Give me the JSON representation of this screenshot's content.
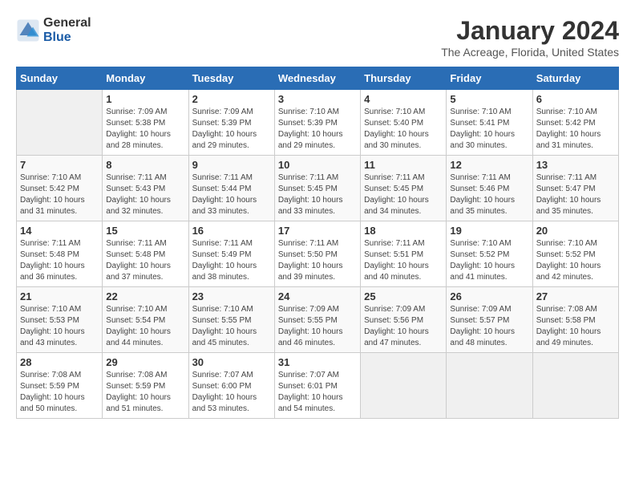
{
  "logo": {
    "general": "General",
    "blue": "Blue"
  },
  "title": "January 2024",
  "subtitle": "The Acreage, Florida, United States",
  "days_of_week": [
    "Sunday",
    "Monday",
    "Tuesday",
    "Wednesday",
    "Thursday",
    "Friday",
    "Saturday"
  ],
  "weeks": [
    [
      {
        "day": "",
        "info": ""
      },
      {
        "day": "1",
        "info": "Sunrise: 7:09 AM\nSunset: 5:38 PM\nDaylight: 10 hours\nand 28 minutes."
      },
      {
        "day": "2",
        "info": "Sunrise: 7:09 AM\nSunset: 5:39 PM\nDaylight: 10 hours\nand 29 minutes."
      },
      {
        "day": "3",
        "info": "Sunrise: 7:10 AM\nSunset: 5:39 PM\nDaylight: 10 hours\nand 29 minutes."
      },
      {
        "day": "4",
        "info": "Sunrise: 7:10 AM\nSunset: 5:40 PM\nDaylight: 10 hours\nand 30 minutes."
      },
      {
        "day": "5",
        "info": "Sunrise: 7:10 AM\nSunset: 5:41 PM\nDaylight: 10 hours\nand 30 minutes."
      },
      {
        "day": "6",
        "info": "Sunrise: 7:10 AM\nSunset: 5:42 PM\nDaylight: 10 hours\nand 31 minutes."
      }
    ],
    [
      {
        "day": "7",
        "info": "Sunrise: 7:10 AM\nSunset: 5:42 PM\nDaylight: 10 hours\nand 31 minutes."
      },
      {
        "day": "8",
        "info": "Sunrise: 7:11 AM\nSunset: 5:43 PM\nDaylight: 10 hours\nand 32 minutes."
      },
      {
        "day": "9",
        "info": "Sunrise: 7:11 AM\nSunset: 5:44 PM\nDaylight: 10 hours\nand 33 minutes."
      },
      {
        "day": "10",
        "info": "Sunrise: 7:11 AM\nSunset: 5:45 PM\nDaylight: 10 hours\nand 33 minutes."
      },
      {
        "day": "11",
        "info": "Sunrise: 7:11 AM\nSunset: 5:45 PM\nDaylight: 10 hours\nand 34 minutes."
      },
      {
        "day": "12",
        "info": "Sunrise: 7:11 AM\nSunset: 5:46 PM\nDaylight: 10 hours\nand 35 minutes."
      },
      {
        "day": "13",
        "info": "Sunrise: 7:11 AM\nSunset: 5:47 PM\nDaylight: 10 hours\nand 35 minutes."
      }
    ],
    [
      {
        "day": "14",
        "info": "Sunrise: 7:11 AM\nSunset: 5:48 PM\nDaylight: 10 hours\nand 36 minutes."
      },
      {
        "day": "15",
        "info": "Sunrise: 7:11 AM\nSunset: 5:48 PM\nDaylight: 10 hours\nand 37 minutes."
      },
      {
        "day": "16",
        "info": "Sunrise: 7:11 AM\nSunset: 5:49 PM\nDaylight: 10 hours\nand 38 minutes."
      },
      {
        "day": "17",
        "info": "Sunrise: 7:11 AM\nSunset: 5:50 PM\nDaylight: 10 hours\nand 39 minutes."
      },
      {
        "day": "18",
        "info": "Sunrise: 7:11 AM\nSunset: 5:51 PM\nDaylight: 10 hours\nand 40 minutes."
      },
      {
        "day": "19",
        "info": "Sunrise: 7:10 AM\nSunset: 5:52 PM\nDaylight: 10 hours\nand 41 minutes."
      },
      {
        "day": "20",
        "info": "Sunrise: 7:10 AM\nSunset: 5:52 PM\nDaylight: 10 hours\nand 42 minutes."
      }
    ],
    [
      {
        "day": "21",
        "info": "Sunrise: 7:10 AM\nSunset: 5:53 PM\nDaylight: 10 hours\nand 43 minutes."
      },
      {
        "day": "22",
        "info": "Sunrise: 7:10 AM\nSunset: 5:54 PM\nDaylight: 10 hours\nand 44 minutes."
      },
      {
        "day": "23",
        "info": "Sunrise: 7:10 AM\nSunset: 5:55 PM\nDaylight: 10 hours\nand 45 minutes."
      },
      {
        "day": "24",
        "info": "Sunrise: 7:09 AM\nSunset: 5:55 PM\nDaylight: 10 hours\nand 46 minutes."
      },
      {
        "day": "25",
        "info": "Sunrise: 7:09 AM\nSunset: 5:56 PM\nDaylight: 10 hours\nand 47 minutes."
      },
      {
        "day": "26",
        "info": "Sunrise: 7:09 AM\nSunset: 5:57 PM\nDaylight: 10 hours\nand 48 minutes."
      },
      {
        "day": "27",
        "info": "Sunrise: 7:08 AM\nSunset: 5:58 PM\nDaylight: 10 hours\nand 49 minutes."
      }
    ],
    [
      {
        "day": "28",
        "info": "Sunrise: 7:08 AM\nSunset: 5:59 PM\nDaylight: 10 hours\nand 50 minutes."
      },
      {
        "day": "29",
        "info": "Sunrise: 7:08 AM\nSunset: 5:59 PM\nDaylight: 10 hours\nand 51 minutes."
      },
      {
        "day": "30",
        "info": "Sunrise: 7:07 AM\nSunset: 6:00 PM\nDaylight: 10 hours\nand 53 minutes."
      },
      {
        "day": "31",
        "info": "Sunrise: 7:07 AM\nSunset: 6:01 PM\nDaylight: 10 hours\nand 54 minutes."
      },
      {
        "day": "",
        "info": ""
      },
      {
        "day": "",
        "info": ""
      },
      {
        "day": "",
        "info": ""
      }
    ]
  ]
}
